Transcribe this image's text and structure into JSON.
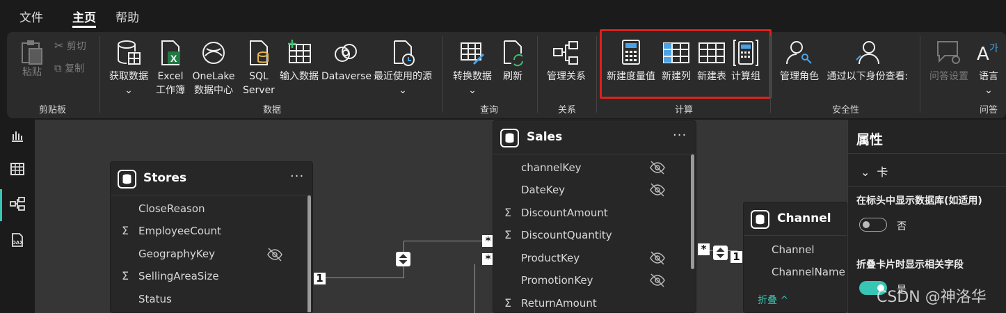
{
  "menu": {
    "file": "文件",
    "home": "主页",
    "help": "帮助"
  },
  "ribbon": {
    "clipboard": {
      "paste": "粘贴",
      "cut": "剪切",
      "copy": "复制",
      "group": "剪贴板"
    },
    "data": {
      "get_data": "获取数据",
      "excel_line1": "Excel",
      "excel_line2": "工作簿",
      "onelake_line1": "OneLake",
      "onelake_line2": "数据中心",
      "sql_line1": "SQL",
      "sql_line2": "Server",
      "enter_data": "输入数据",
      "dataverse": "Dataverse",
      "recent": "最近使用的源",
      "group": "数据"
    },
    "query": {
      "transform": "转换数据",
      "refresh": "刷新",
      "group": "查询"
    },
    "relationships": {
      "manage": "管理关系",
      "group": "关系"
    },
    "calculations": {
      "new_measure": "新建度量值",
      "new_column": "新建列",
      "new_table": "新建表",
      "calc_group": "计算组",
      "group": "计算"
    },
    "security": {
      "manage_roles": "管理角色",
      "view_as": "通过以下身份查看:",
      "group": "安全性"
    },
    "qa": {
      "settings": "问答设置",
      "language": "语言",
      "group": "问答"
    }
  },
  "tables": {
    "stores": {
      "title": "Stores",
      "fields": [
        "CloseReason",
        "EmployeeCount",
        "GeographyKey",
        "SellingAreaSize",
        "Status"
      ]
    },
    "sales": {
      "title": "Sales",
      "fields": [
        "channelKey",
        "DateKey",
        "DiscountAmount",
        "DiscountQuantity",
        "ProductKey",
        "PromotionKey",
        "ReturnAmount"
      ]
    },
    "channel": {
      "title": "Channel",
      "fields": [
        "Channel",
        "ChannelName"
      ],
      "collapse": "折叠 ^"
    }
  },
  "markers": {
    "one": "1",
    "many": "*"
  },
  "properties": {
    "title": "属性",
    "section": "卡",
    "show_db_label": "在标头中显示数据库(如适用)",
    "show_db_value": "否",
    "show_related_label": "折叠卡片时显示相关字段",
    "show_related_value": "是"
  },
  "colors": {
    "accent": "#37c6b5",
    "highlight": "#e0201c",
    "excel": "#1f7a44"
  },
  "watermark": "CSDN @神洛华"
}
